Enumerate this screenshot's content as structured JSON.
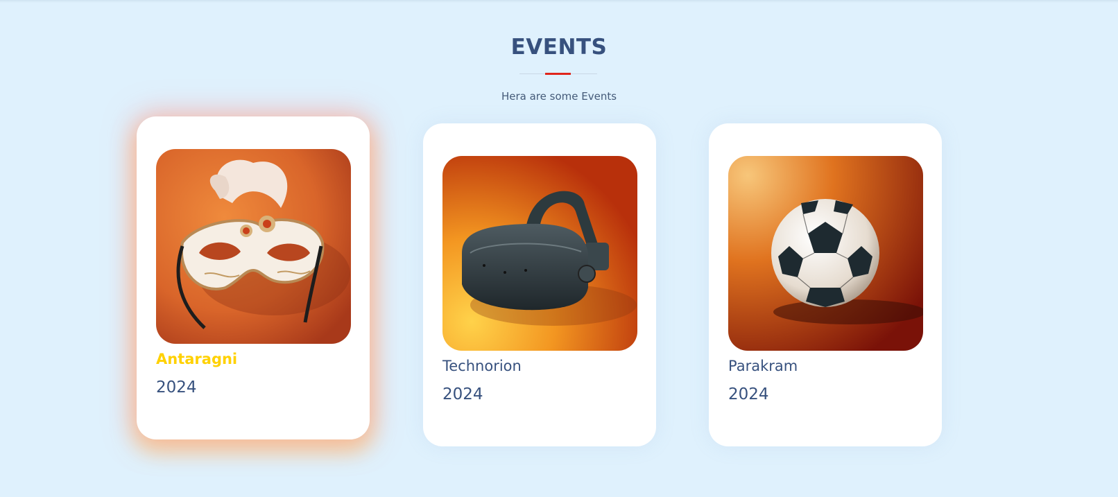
{
  "section": {
    "title": "EVENTS",
    "subtitle": "Hera are some Events",
    "accent_color": "#e0251b",
    "title_color": "#37517e"
  },
  "events": [
    {
      "name": "Antaragni",
      "year": "2024",
      "image": "carnival-mask-icon",
      "highlighted": true,
      "name_color": "#ffd100"
    },
    {
      "name": "Technorion",
      "year": "2024",
      "image": "vr-headset-icon",
      "highlighted": false
    },
    {
      "name": "Parakram",
      "year": "2024",
      "image": "soccer-ball-icon",
      "highlighted": false
    }
  ]
}
